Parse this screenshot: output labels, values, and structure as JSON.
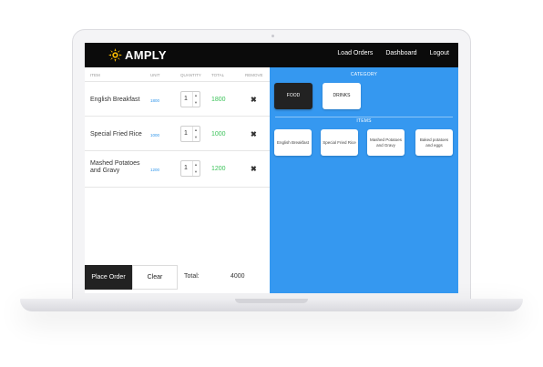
{
  "app": {
    "brand": "AMPLY"
  },
  "nav": {
    "load_orders": "Load Orders",
    "dashboard": "Dashboard",
    "logout": "Logout"
  },
  "order_table": {
    "headers": {
      "item": "ITEM",
      "unit": "UNIT",
      "quantity": "QUANTITY",
      "total": "TOTAL",
      "remove": "REMOVE"
    },
    "rows": [
      {
        "name": "English Breakfast",
        "unit": "1800",
        "quantity": "1",
        "total": "1800",
        "remove": "✖"
      },
      {
        "name": "Special Fried Rice",
        "unit": "1000",
        "quantity": "1",
        "total": "1000",
        "remove": "✖"
      },
      {
        "name": "Mashed Potatoes and Gravy",
        "unit": "1200",
        "quantity": "1",
        "total": "1200",
        "remove": "✖"
      }
    ]
  },
  "footer": {
    "place_order": "Place Order",
    "clear": "Clear",
    "total_label": "Total:",
    "total_value": "4000"
  },
  "menu": {
    "category_title": "CATEGORY",
    "categories": [
      {
        "label": "FOOD",
        "selected": true
      },
      {
        "label": "DRINKS",
        "selected": false
      }
    ],
    "items_title": "ITEMS",
    "items": [
      {
        "label": "English Breakfast"
      },
      {
        "label": "Special Fried Rice"
      },
      {
        "label": "Mashed Potatoes and Gravy"
      },
      {
        "label": "Baked potatoes and eggs"
      }
    ]
  },
  "colors": {
    "accent": "#3598f0",
    "topbar": "#0b0b0b",
    "total_green": "#3cc35a",
    "unit_blue": "#2f95ea",
    "logo_yellow": "#f5b800"
  },
  "icons": {
    "logo": "sun-icon",
    "remove": "close-icon",
    "stepper_up": "chevron-up-icon",
    "stepper_down": "chevron-down-icon"
  }
}
